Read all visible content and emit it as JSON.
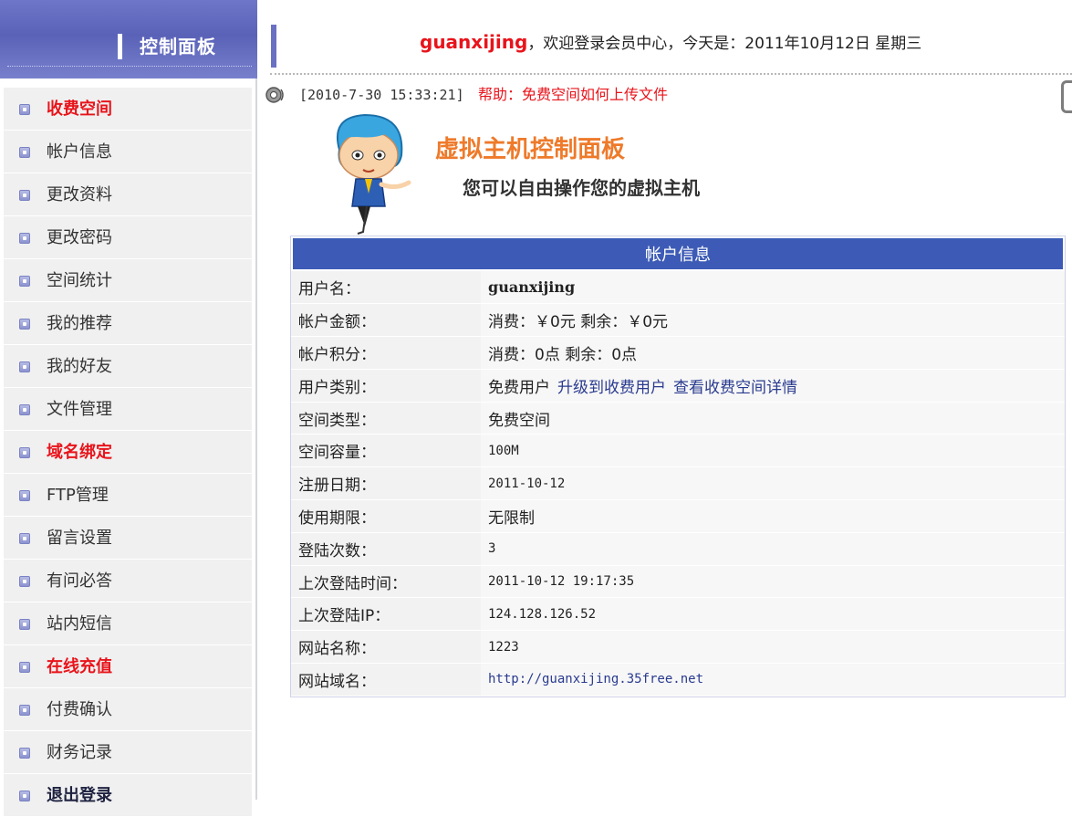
{
  "sidebar": {
    "title": "控制面板",
    "items": [
      {
        "label": "收费空间",
        "style": "hot"
      },
      {
        "label": "帐户信息",
        "style": ""
      },
      {
        "label": "更改资料",
        "style": ""
      },
      {
        "label": "更改密码",
        "style": ""
      },
      {
        "label": "空间统计",
        "style": ""
      },
      {
        "label": "我的推荐",
        "style": ""
      },
      {
        "label": "我的好友",
        "style": ""
      },
      {
        "label": "文件管理",
        "style": ""
      },
      {
        "label": "域名绑定",
        "style": "hot"
      },
      {
        "label": "FTP管理",
        "style": ""
      },
      {
        "label": "留言设置",
        "style": ""
      },
      {
        "label": "有问必答",
        "style": ""
      },
      {
        "label": "站内短信",
        "style": ""
      },
      {
        "label": "在线充值",
        "style": "hot"
      },
      {
        "label": "付费确认",
        "style": ""
      },
      {
        "label": "财务记录",
        "style": ""
      },
      {
        "label": "退出登录",
        "style": "bold"
      }
    ]
  },
  "header": {
    "username": "guanxijing",
    "welcome_text": "，欢迎登录会员中心，今天是：2011年10月12日 星期三"
  },
  "notice": {
    "date": "[2010-7-30 15:33:21]",
    "link": "帮助：免费空间如何上传文件"
  },
  "panel": {
    "title": "虚拟主机控制面板",
    "subtitle": "您可以自由操作您的虚拟主机"
  },
  "account": {
    "heading": "帐户信息",
    "rows": {
      "username": {
        "key": "用户名：",
        "value": "guanxijing"
      },
      "balance": {
        "key": "帐户金额：",
        "value": "消费：￥0元 剩余：￥0元"
      },
      "points": {
        "key": "帐户积分：",
        "value": "消费：0点 剩余：0点"
      },
      "user_type": {
        "key": "用户类别：",
        "value": "免费用户",
        "link1": "升级到收费用户",
        "link2": "查看收费空间详情"
      },
      "space_type": {
        "key": "空间类型：",
        "value": "免费空间"
      },
      "capacity": {
        "key": "空间容量：",
        "value": "100M"
      },
      "reg_date": {
        "key": "注册日期：",
        "value": "2011-10-12"
      },
      "term": {
        "key": "使用期限：",
        "value": "无限制"
      },
      "login_count": {
        "key": "登陆次数：",
        "value": "3"
      },
      "last_login_time": {
        "key": "上次登陆时间：",
        "value": "2011-10-12 19:17:35"
      },
      "last_login_ip": {
        "key": "上次登陆IP：",
        "value": "124.128.126.52"
      },
      "site_name": {
        "key": "网站名称：",
        "value": "1223"
      },
      "site_domain": {
        "key": "网站域名：",
        "value": "http://guanxijing.35free.net"
      }
    }
  },
  "colors": {
    "accent": "#5a62b8",
    "table_head": "#3d5bb6",
    "highlight_red": "#e8141b",
    "title_orange": "#ee7a2a"
  }
}
